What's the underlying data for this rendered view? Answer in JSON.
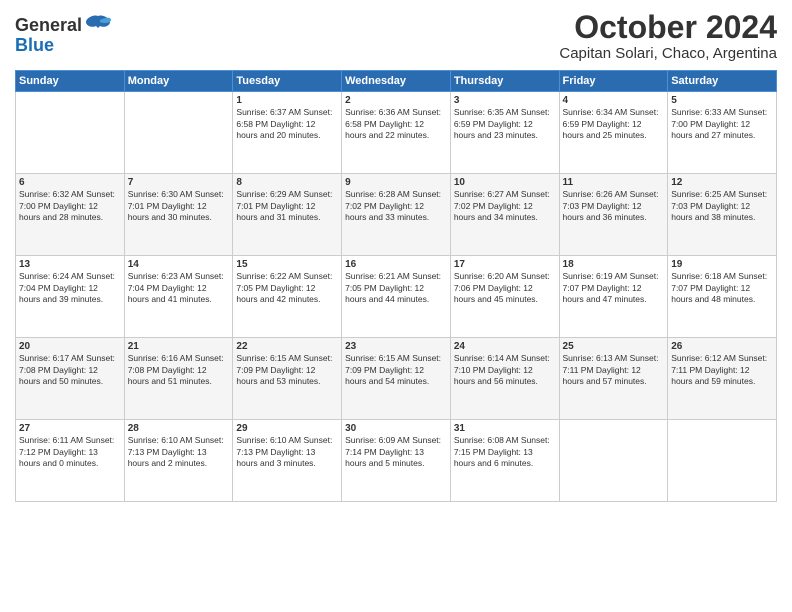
{
  "header": {
    "logo_general": "General",
    "logo_blue": "Blue",
    "title": "October 2024",
    "subtitle": "Capitan Solari, Chaco, Argentina"
  },
  "days_of_week": [
    "Sunday",
    "Monday",
    "Tuesday",
    "Wednesday",
    "Thursday",
    "Friday",
    "Saturday"
  ],
  "weeks": [
    [
      {
        "day": "",
        "info": ""
      },
      {
        "day": "",
        "info": ""
      },
      {
        "day": "1",
        "info": "Sunrise: 6:37 AM\nSunset: 6:58 PM\nDaylight: 12 hours\nand 20 minutes."
      },
      {
        "day": "2",
        "info": "Sunrise: 6:36 AM\nSunset: 6:58 PM\nDaylight: 12 hours\nand 22 minutes."
      },
      {
        "day": "3",
        "info": "Sunrise: 6:35 AM\nSunset: 6:59 PM\nDaylight: 12 hours\nand 23 minutes."
      },
      {
        "day": "4",
        "info": "Sunrise: 6:34 AM\nSunset: 6:59 PM\nDaylight: 12 hours\nand 25 minutes."
      },
      {
        "day": "5",
        "info": "Sunrise: 6:33 AM\nSunset: 7:00 PM\nDaylight: 12 hours\nand 27 minutes."
      }
    ],
    [
      {
        "day": "6",
        "info": "Sunrise: 6:32 AM\nSunset: 7:00 PM\nDaylight: 12 hours\nand 28 minutes."
      },
      {
        "day": "7",
        "info": "Sunrise: 6:30 AM\nSunset: 7:01 PM\nDaylight: 12 hours\nand 30 minutes."
      },
      {
        "day": "8",
        "info": "Sunrise: 6:29 AM\nSunset: 7:01 PM\nDaylight: 12 hours\nand 31 minutes."
      },
      {
        "day": "9",
        "info": "Sunrise: 6:28 AM\nSunset: 7:02 PM\nDaylight: 12 hours\nand 33 minutes."
      },
      {
        "day": "10",
        "info": "Sunrise: 6:27 AM\nSunset: 7:02 PM\nDaylight: 12 hours\nand 34 minutes."
      },
      {
        "day": "11",
        "info": "Sunrise: 6:26 AM\nSunset: 7:03 PM\nDaylight: 12 hours\nand 36 minutes."
      },
      {
        "day": "12",
        "info": "Sunrise: 6:25 AM\nSunset: 7:03 PM\nDaylight: 12 hours\nand 38 minutes."
      }
    ],
    [
      {
        "day": "13",
        "info": "Sunrise: 6:24 AM\nSunset: 7:04 PM\nDaylight: 12 hours\nand 39 minutes."
      },
      {
        "day": "14",
        "info": "Sunrise: 6:23 AM\nSunset: 7:04 PM\nDaylight: 12 hours\nand 41 minutes."
      },
      {
        "day": "15",
        "info": "Sunrise: 6:22 AM\nSunset: 7:05 PM\nDaylight: 12 hours\nand 42 minutes."
      },
      {
        "day": "16",
        "info": "Sunrise: 6:21 AM\nSunset: 7:05 PM\nDaylight: 12 hours\nand 44 minutes."
      },
      {
        "day": "17",
        "info": "Sunrise: 6:20 AM\nSunset: 7:06 PM\nDaylight: 12 hours\nand 45 minutes."
      },
      {
        "day": "18",
        "info": "Sunrise: 6:19 AM\nSunset: 7:07 PM\nDaylight: 12 hours\nand 47 minutes."
      },
      {
        "day": "19",
        "info": "Sunrise: 6:18 AM\nSunset: 7:07 PM\nDaylight: 12 hours\nand 48 minutes."
      }
    ],
    [
      {
        "day": "20",
        "info": "Sunrise: 6:17 AM\nSunset: 7:08 PM\nDaylight: 12 hours\nand 50 minutes."
      },
      {
        "day": "21",
        "info": "Sunrise: 6:16 AM\nSunset: 7:08 PM\nDaylight: 12 hours\nand 51 minutes."
      },
      {
        "day": "22",
        "info": "Sunrise: 6:15 AM\nSunset: 7:09 PM\nDaylight: 12 hours\nand 53 minutes."
      },
      {
        "day": "23",
        "info": "Sunrise: 6:15 AM\nSunset: 7:09 PM\nDaylight: 12 hours\nand 54 minutes."
      },
      {
        "day": "24",
        "info": "Sunrise: 6:14 AM\nSunset: 7:10 PM\nDaylight: 12 hours\nand 56 minutes."
      },
      {
        "day": "25",
        "info": "Sunrise: 6:13 AM\nSunset: 7:11 PM\nDaylight: 12 hours\nand 57 minutes."
      },
      {
        "day": "26",
        "info": "Sunrise: 6:12 AM\nSunset: 7:11 PM\nDaylight: 12 hours\nand 59 minutes."
      }
    ],
    [
      {
        "day": "27",
        "info": "Sunrise: 6:11 AM\nSunset: 7:12 PM\nDaylight: 13 hours\nand 0 minutes."
      },
      {
        "day": "28",
        "info": "Sunrise: 6:10 AM\nSunset: 7:13 PM\nDaylight: 13 hours\nand 2 minutes."
      },
      {
        "day": "29",
        "info": "Sunrise: 6:10 AM\nSunset: 7:13 PM\nDaylight: 13 hours\nand 3 minutes."
      },
      {
        "day": "30",
        "info": "Sunrise: 6:09 AM\nSunset: 7:14 PM\nDaylight: 13 hours\nand 5 minutes."
      },
      {
        "day": "31",
        "info": "Sunrise: 6:08 AM\nSunset: 7:15 PM\nDaylight: 13 hours\nand 6 minutes."
      },
      {
        "day": "",
        "info": ""
      },
      {
        "day": "",
        "info": ""
      }
    ]
  ]
}
